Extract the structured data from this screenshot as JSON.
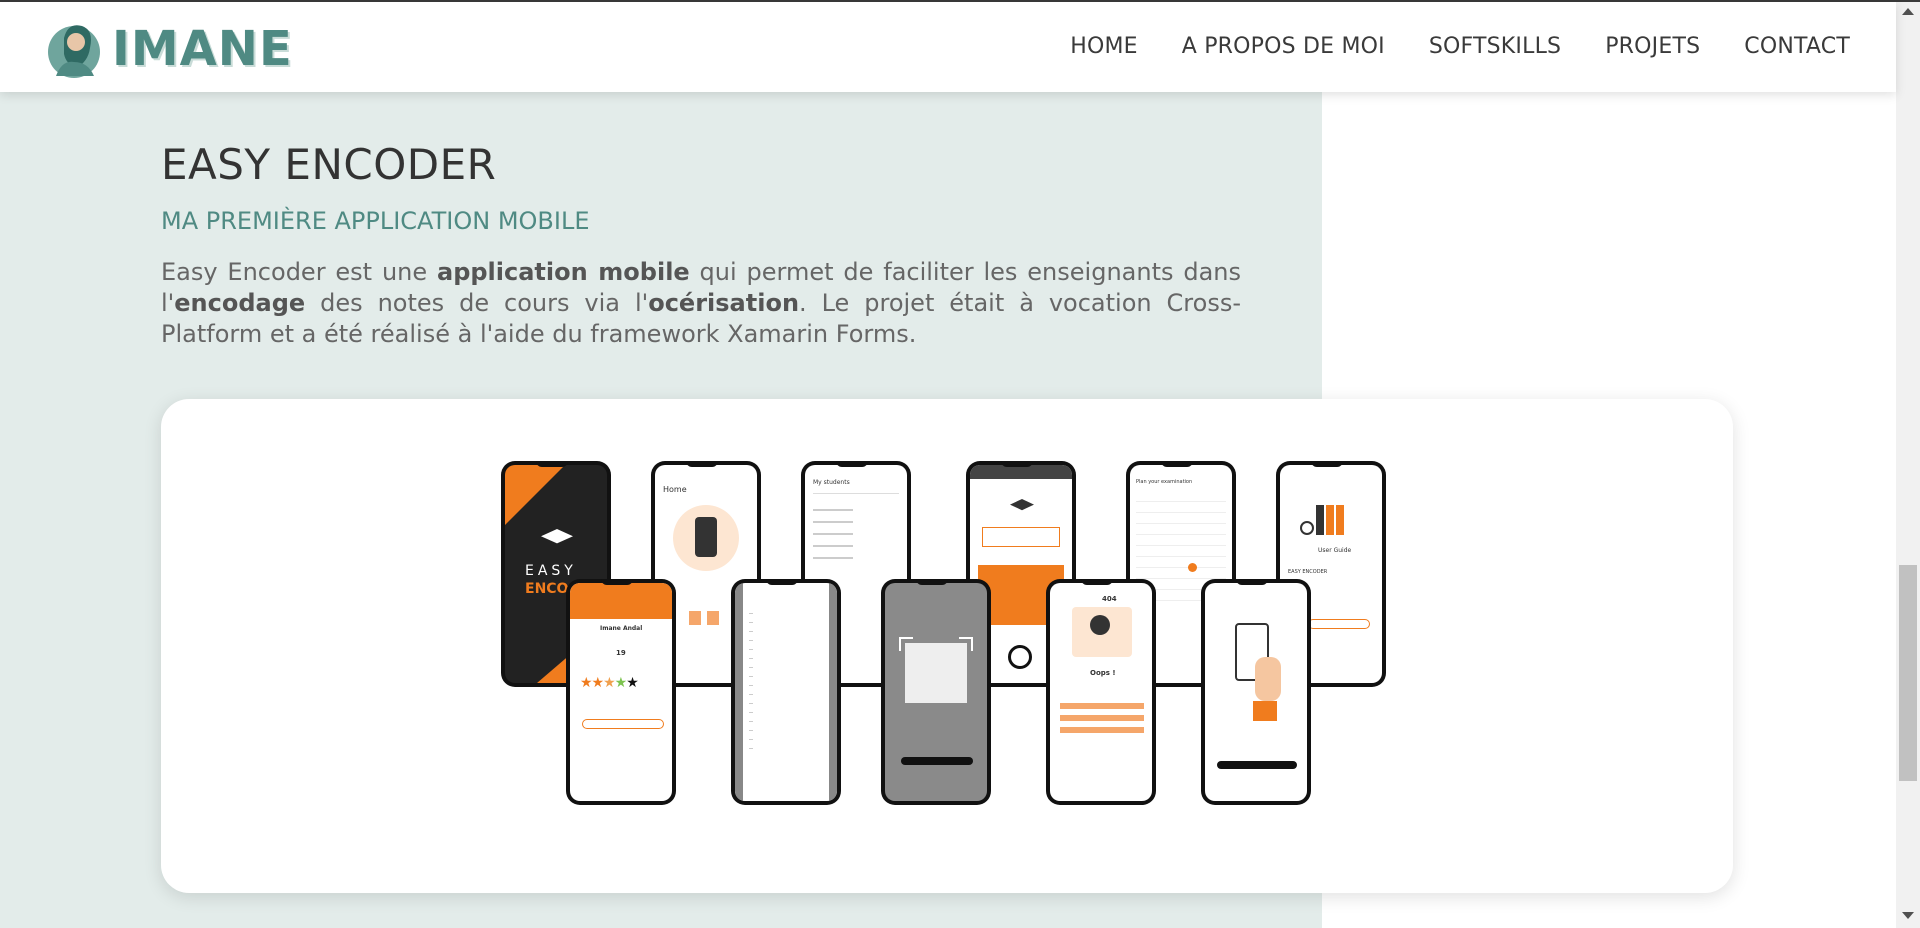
{
  "nav": {
    "logo_text": "IMANE",
    "items": [
      "HOME",
      "A PROPOS DE MOI",
      "SOFTSKILLS",
      "PROJETS",
      "CONTACT"
    ]
  },
  "project": {
    "title": "EASY ENCODER",
    "subtitle": "MA PREMIÈRE APPLICATION MOBILE",
    "desc": {
      "p1": "Easy Encoder est une ",
      "b1": "application mobile",
      "p2": " qui permet de faciliter les enseignants dans l'",
      "b2": "encodage",
      "p3": " des notes de cours via l'",
      "b3": "océrisation",
      "p4": ". Le projet était à vocation Cross-Platform et a été réalisé à l'aide du framework Xamarin Forms."
    }
  },
  "mockup": {
    "splash_text_1": "EASY",
    "splash_text_2": "ENCO",
    "home_label": "Home",
    "students_label": "My students",
    "plan_label": "Plan your examination",
    "guide_label": "User Guide",
    "easy_encoder_label": "EASY ENCODER",
    "score_label": "Imane Andal",
    "score_value": "19",
    "oops_label": "Oops !",
    "error_code": "404"
  },
  "colors": {
    "accent": "#4f8a83",
    "mint_bg": "#e3ecea",
    "orange": "#f07c1e"
  }
}
